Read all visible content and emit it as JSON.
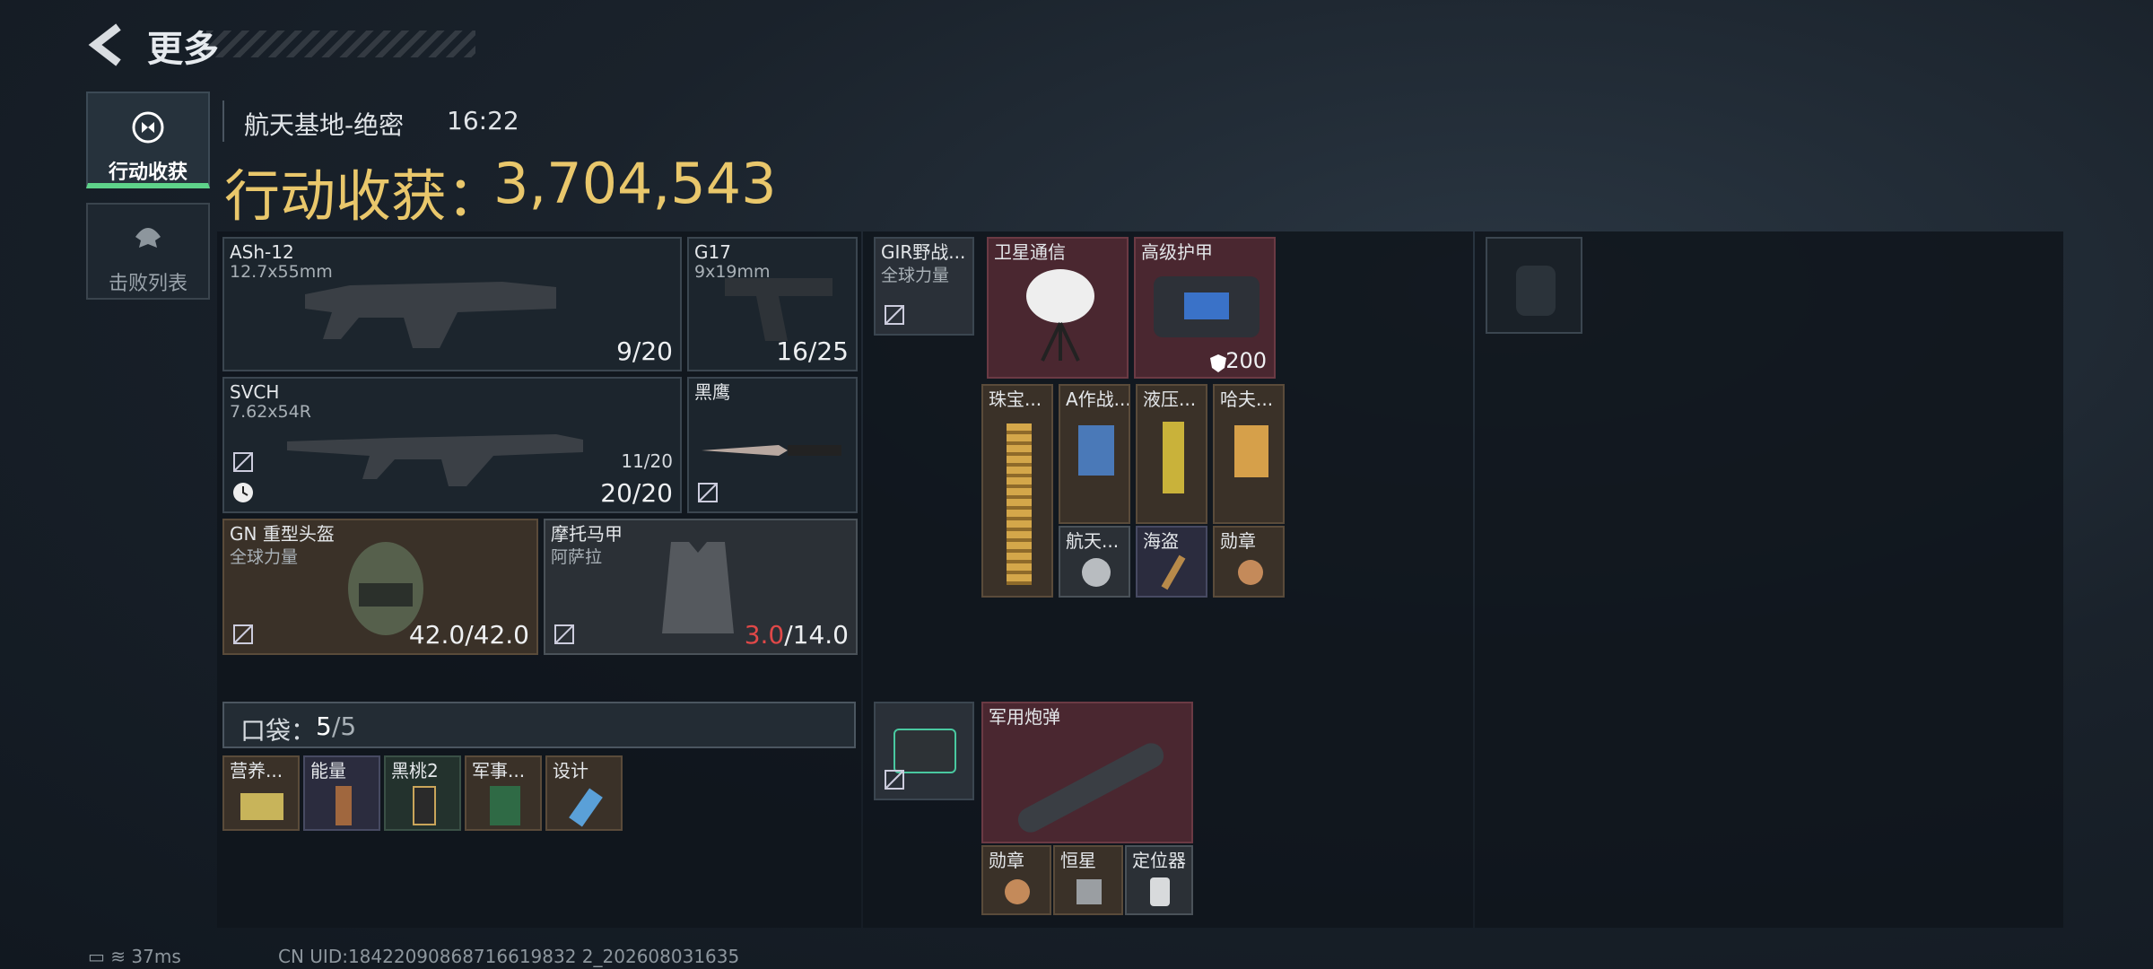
{
  "header": {
    "title": "更多",
    "back_icon": "back-arrow-icon"
  },
  "tabs": [
    {
      "label": "行动收获",
      "icon": "loot-icon",
      "active": true
    },
    {
      "label": "击败列表",
      "icon": "skull-icon",
      "active": false
    }
  ],
  "raid": {
    "map": "航天基地-绝密",
    "time": "16:22",
    "haul_label": "行动收获：",
    "haul_value": "3,704,543"
  },
  "loadout": {
    "primary": {
      "name": "ASh-12",
      "ammo": "12.7x55mm",
      "count": "9/20"
    },
    "pistol": {
      "name": "G17",
      "ammo": "9x19mm",
      "count": "16/25"
    },
    "secondary": {
      "name": "SVCH",
      "ammo": "7.62x54R",
      "mag": "11/20",
      "count": "20/20"
    },
    "melee": {
      "name": "黑鹰"
    },
    "helmet": {
      "name": "GN 重型头盔",
      "brand": "全球力量",
      "durability": "42.0/42.0"
    },
    "armor": {
      "name": "摩托马甲",
      "brand": "阿萨拉",
      "durability_current": "3.0",
      "durability_max": "/14.0"
    }
  },
  "pocket": {
    "label": "口袋：",
    "used": "5",
    "total": "/5",
    "items": [
      {
        "name": "营养...",
        "color": "brown"
      },
      {
        "name": "能量",
        "color": "purple"
      },
      {
        "name": "黑桃2",
        "color": "green"
      },
      {
        "name": "军事...",
        "color": "brown"
      },
      {
        "name": "设计",
        "color": "brown"
      }
    ]
  },
  "rig": {
    "name": "GIR野战...",
    "brand": "全球力量",
    "items": [
      {
        "name": "卫星通信"
      },
      {
        "name": "高级护甲",
        "count": "200"
      },
      {
        "name": "珠宝..."
      },
      {
        "name": "A作战..."
      },
      {
        "name": "液压..."
      },
      {
        "name": "哈夫..."
      },
      {
        "name": "航天..."
      },
      {
        "name": "海盗"
      },
      {
        "name": "勋章"
      }
    ]
  },
  "bag2": {
    "items": [
      {
        "name": "军用炮弹"
      },
      {
        "name": "勋章"
      },
      {
        "name": "恒星"
      },
      {
        "name": "定位器"
      }
    ]
  },
  "status": {
    "ping": "37ms",
    "uid": "CN UID:18422090868716619832 2_202608031635"
  }
}
